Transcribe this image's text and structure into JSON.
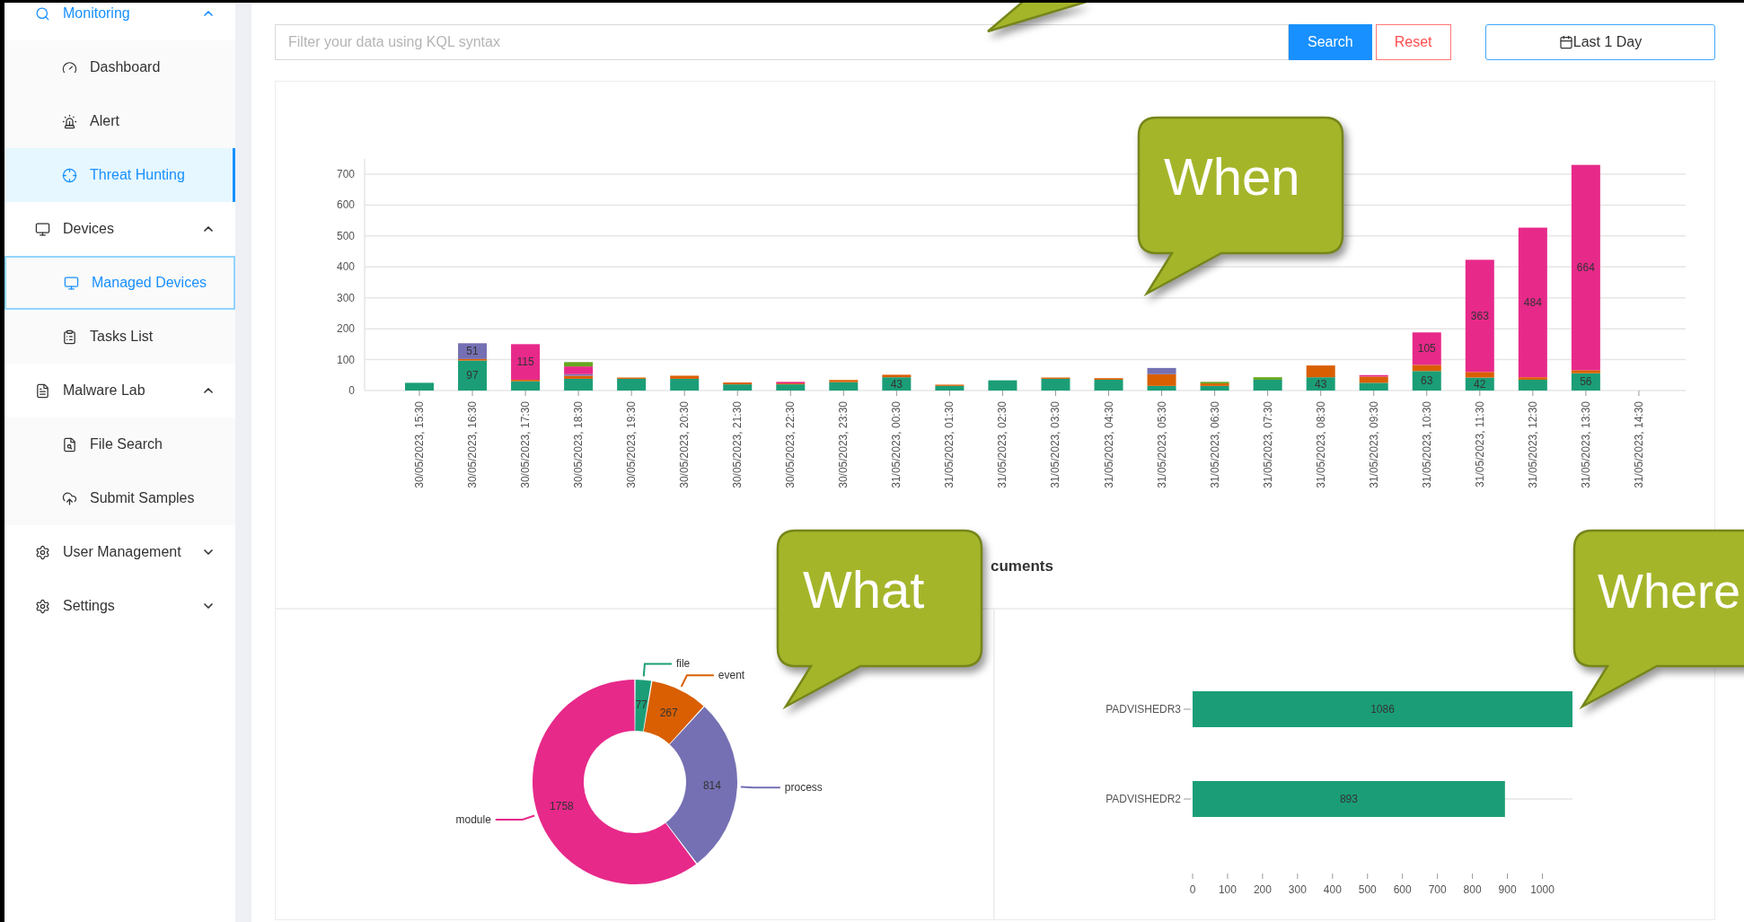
{
  "sidebar": {
    "groups": [
      {
        "label": "Monitoring",
        "expanded": true,
        "active": true,
        "children": [
          {
            "label": "Dashboard",
            "selected": false,
            "focused": false
          },
          {
            "label": "Alert",
            "selected": false,
            "focused": false
          },
          {
            "label": "Threat Hunting",
            "selected": true,
            "focused": false
          }
        ]
      },
      {
        "label": "Devices",
        "expanded": true,
        "active": false,
        "children": [
          {
            "label": "Managed Devices",
            "selected": false,
            "focused": true
          },
          {
            "label": "Tasks List",
            "selected": false,
            "focused": false
          }
        ]
      },
      {
        "label": "Malware Lab",
        "expanded": true,
        "active": false,
        "children": [
          {
            "label": "File Search",
            "selected": false,
            "focused": false
          },
          {
            "label": "Submit Samples",
            "selected": false,
            "focused": false
          }
        ]
      },
      {
        "label": "User Management",
        "expanded": false,
        "active": false
      },
      {
        "label": "Settings",
        "expanded": false,
        "active": false
      }
    ]
  },
  "search_bar": {
    "placeholder": "Filter your data using KQL syntax",
    "buttons": [
      {
        "label": "Search",
        "kind": "primary"
      },
      {
        "label": "Reset",
        "kind": "danger"
      }
    ],
    "date_range": {
      "label": "Last 1 Day"
    }
  },
  "timeline": {
    "chart_data": {
      "type": "bar",
      "stacked": true,
      "grid": true,
      "ylim": [
        0,
        750
      ],
      "yticks": [
        0,
        100,
        200,
        300,
        400,
        500,
        600,
        700
      ],
      "categories": [
        "30/05/2023, 15:30",
        "30/05/2023, 16:30",
        "30/05/2023, 17:30",
        "30/05/2023, 18:30",
        "30/05/2023, 19:30",
        "30/05/2023, 20:30",
        "30/05/2023, 21:30",
        "30/05/2023, 22:30",
        "30/05/2023, 23:30",
        "31/05/2023, 00:30",
        "31/05/2023, 01:30",
        "31/05/2023, 02:30",
        "31/05/2023, 03:30",
        "31/05/2023, 04:30",
        "31/05/2023, 05:30",
        "31/05/2023, 06:30",
        "31/05/2023, 07:30",
        "31/05/2023, 08:30",
        "31/05/2023, 09:30",
        "31/05/2023, 10:30",
        "31/05/2023, 11:30",
        "31/05/2023, 12:30",
        "31/05/2023, 13:30",
        "31/05/2023, 14:30"
      ],
      "series": [
        {
          "color": "#1b9e77",
          "values": [
            25,
            97,
            30,
            38,
            38,
            38,
            20,
            20,
            27,
            43,
            15,
            33,
            38,
            35,
            15,
            15,
            35,
            43,
            25,
            63,
            42,
            35,
            56,
            null
          ],
          "value_labels": [
            null,
            "97",
            null,
            null,
            null,
            null,
            null,
            null,
            null,
            "43",
            null,
            null,
            null,
            null,
            null,
            null,
            null,
            "43",
            null,
            "63",
            "42",
            null,
            "56",
            null
          ]
        },
        {
          "color": "#d95f02",
          "values": [
            null,
            5,
            5,
            10,
            4,
            10,
            6,
            3,
            7,
            8,
            4,
            null,
            4,
            5,
            38,
            8,
            null,
            38,
            20,
            20,
            18,
            8,
            10,
            null
          ]
        },
        {
          "color": "#7570b3",
          "values": [
            null,
            51,
            null,
            5,
            null,
            null,
            null,
            null,
            null,
            null,
            null,
            null,
            null,
            null,
            20,
            null,
            null,
            null,
            null,
            null,
            null,
            null,
            null,
            null
          ],
          "value_labels": [
            null,
            "51",
            null,
            null,
            null,
            null,
            null,
            null,
            null,
            null,
            null,
            null,
            null,
            null,
            null,
            null,
            null,
            null,
            null,
            null,
            null,
            null,
            null,
            null
          ]
        },
        {
          "color": "#e7298a",
          "values": [
            null,
            null,
            115,
            25,
            null,
            null,
            null,
            5,
            null,
            null,
            null,
            null,
            null,
            null,
            null,
            null,
            null,
            null,
            5,
            105,
            363,
            484,
            664,
            null
          ],
          "value_labels": [
            null,
            null,
            "115",
            null,
            null,
            null,
            null,
            null,
            null,
            null,
            null,
            null,
            null,
            null,
            null,
            null,
            null,
            null,
            null,
            "105",
            "363",
            "484",
            "664",
            null
          ]
        },
        {
          "color": "#66a61e",
          "values": [
            null,
            null,
            null,
            14,
            null,
            null,
            null,
            null,
            null,
            null,
            null,
            null,
            null,
            null,
            null,
            5,
            8,
            null,
            null,
            null,
            null,
            null,
            null,
            null
          ]
        }
      ]
    }
  },
  "documents_title": "cuments",
  "types": {
    "chart_data": {
      "type": "donut",
      "data_labels": true,
      "categories": [
        "file",
        "event",
        "process",
        "module"
      ],
      "values": [
        77,
        267,
        814,
        1758
      ],
      "colors": [
        "#1b9e77",
        "#d95f02",
        "#7570b3",
        "#e7298a"
      ]
    }
  },
  "hosts": {
    "chart_data": {
      "type": "bar",
      "orientation": "horizontal",
      "data_labels": true,
      "categories": [
        "PADVISHEDR3",
        "PADVISHEDR2"
      ],
      "xlim": [
        0,
        1086
      ],
      "xticks": [
        0,
        100,
        200,
        300,
        400,
        500,
        600,
        700,
        800,
        900,
        1000
      ],
      "series": [
        {
          "color": "#1b9e77",
          "values": [
            1086,
            893
          ]
        }
      ]
    }
  },
  "callouts": [
    {
      "text": "When"
    },
    {
      "text": "What"
    },
    {
      "text": "Where"
    }
  ]
}
